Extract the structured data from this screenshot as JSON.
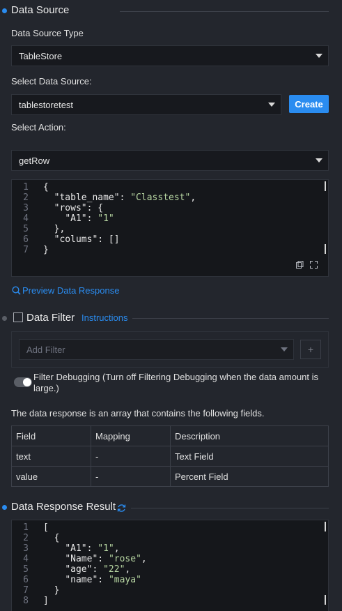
{
  "data_source": {
    "section_title": "Data Source",
    "type_label": "Data Source Type",
    "type_value": "TableStore",
    "select_label": "Select Data Source:",
    "select_value": "tablestoretest",
    "create_label": "Create",
    "action_label": "Select Action:",
    "action_value": "getRow",
    "code_lines": [
      {
        "n": "1",
        "t": "{"
      },
      {
        "n": "2",
        "t": "  \"table_name\": \"Classtest\","
      },
      {
        "n": "3",
        "t": "  \"rows\": {"
      },
      {
        "n": "4",
        "t": "    \"A1\": \"1\""
      },
      {
        "n": "5",
        "t": "  },"
      },
      {
        "n": "6",
        "t": "  \"colums\": []"
      },
      {
        "n": "7",
        "t": "}"
      }
    ],
    "copy_icon": "copy-icon",
    "fullscreen_icon": "fullscreen-icon",
    "preview_label": "Preview Data Response",
    "search_icon": "search-icon"
  },
  "data_filter": {
    "section_title": "Data Filter",
    "instructions_label": "Instructions",
    "add_filter_placeholder": "Add Filter",
    "plus_label": "+",
    "debug_label": "Filter Debugging (Turn off Filtering Debugging when the data amount is large.)"
  },
  "fields": {
    "intro": "The data response is an array that contains the following fields.",
    "headers": [
      "Field",
      "Mapping",
      "Description"
    ],
    "rows": [
      [
        "text",
        "-",
        "Text Field"
      ],
      [
        "value",
        "-",
        "Percent Field"
      ]
    ]
  },
  "response": {
    "section_title": "Data Response Result",
    "refresh_icon": "refresh-icon",
    "code_lines": [
      {
        "n": "1",
        "t": "["
      },
      {
        "n": "2",
        "t": "  {"
      },
      {
        "n": "3",
        "t": "    \"A1\": \"1\","
      },
      {
        "n": "4",
        "t": "    \"Name\": \"rose\","
      },
      {
        "n": "5",
        "t": "    \"age\": \"22\","
      },
      {
        "n": "6",
        "t": "    \"name\": \"maya\""
      },
      {
        "n": "7",
        "t": "  }"
      },
      {
        "n": "8",
        "t": "]"
      }
    ]
  },
  "colors": {
    "accent": "#2a8cf0",
    "background": "#23262d",
    "code_background": "#15171b",
    "string": "#b8d7a3"
  }
}
